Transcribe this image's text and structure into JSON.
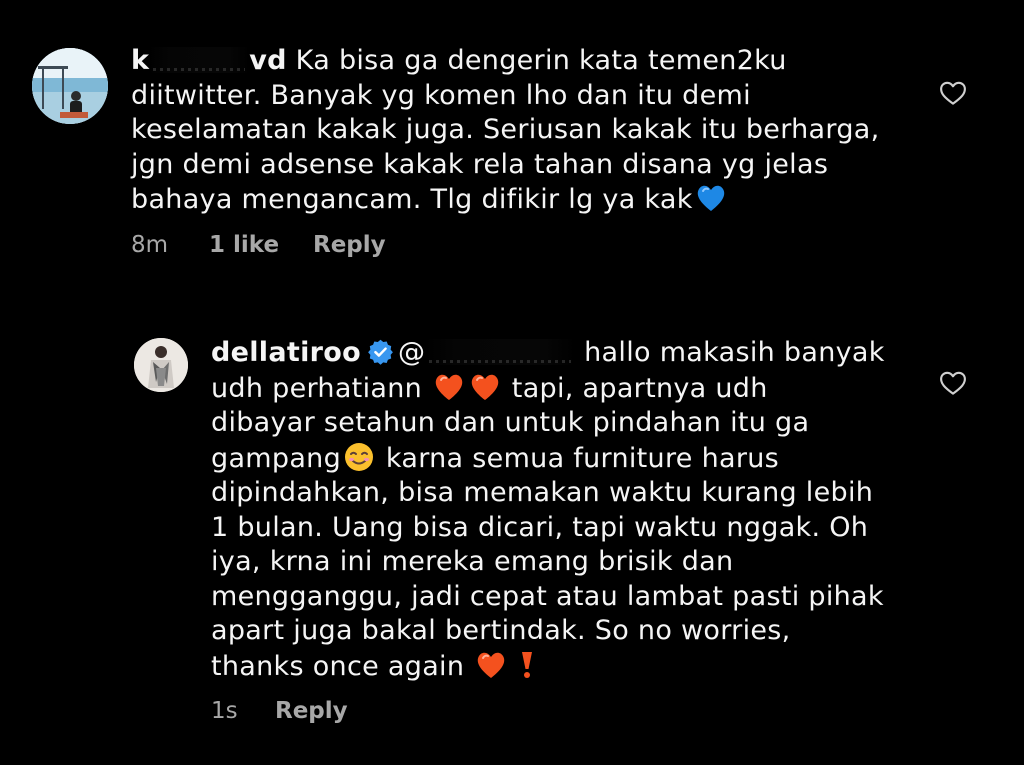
{
  "comments": [
    {
      "username": "k",
      "username_tail": "vd",
      "text_line1": " Ka bisa ga dengerin kata temen2ku",
      "text_rest": "diitwitter. Banyak yg komen lho dan itu demi\nkeselamatan kakak juga. Seriusan kakak itu berharga,\njgn demi adsense kakak rela tahan disana yg jelas\nbahaya mengancam. Tlg difikir lg ya kak",
      "trailing_emoji": "blue-heart",
      "time": "8m",
      "likes": "1 like",
      "reply_label": "Reply",
      "avatar_icon": "profile-photo-beach"
    },
    {
      "username": "dellatiroo",
      "verified": true,
      "mention_prefix": "@",
      "line1_text": " hallo makasih banyak",
      "line2_start": "udh perhatiann ",
      "line2_end": " tapi, apartnya udh",
      "line3": "dibayar setahun dan untuk pindahan itu ga",
      "line4_start": "gampang",
      "line4_end": " karna semua furniture harus",
      "rest": "dipindahkan, bisa memakan waktu kurang lebih\n1 bulan. Uang bisa dicari, tapi waktu nggak. Oh\niya, krna ini mereka emang brisik dan\nmengganggu, jadi cepat atau lambat pasti pihak\napart juga bakal bertindak. So no worries,\nthanks once again ",
      "time": "1s",
      "reply_label": "Reply",
      "avatar_icon": "profile-photo-woman"
    }
  ],
  "colors": {
    "background": "#000000",
    "text": "#f5f5f5",
    "meta": "#a8a8a8",
    "verified": "#3897f0",
    "heart_orange": "#f4511e",
    "heart_blue": "#1e88e5"
  }
}
